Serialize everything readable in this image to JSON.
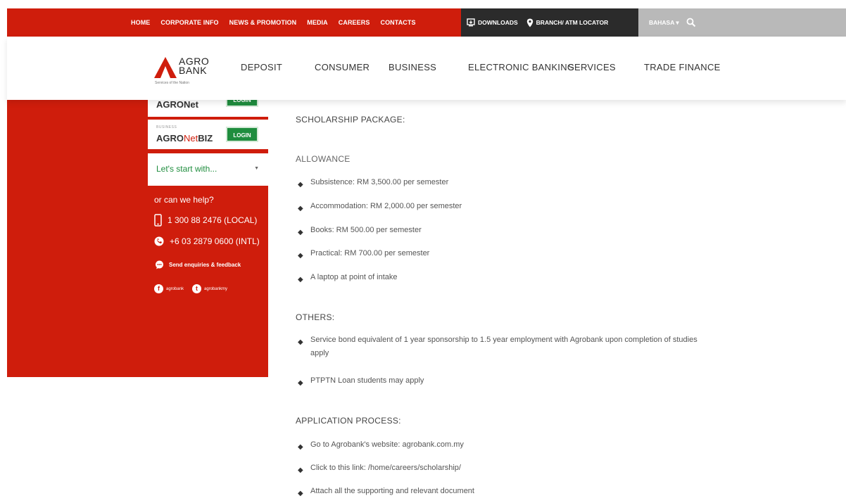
{
  "topbar": {
    "nav": [
      "HOME",
      "CORPORATE INFO",
      "NEWS & PROMOTION",
      "MEDIA",
      "CAREERS",
      "CONTACTS"
    ],
    "downloads": "DOWNLOADS",
    "locator": "BRANCH/ ATM LOCATOR",
    "language": "BAHASA ▾",
    "icons": [
      "download-icon",
      "map-pin-icon",
      "search-icon"
    ]
  },
  "logo": {
    "line1": "AGRO",
    "line2": "BANK",
    "tagline": "Services of the Nation"
  },
  "mainnav": [
    "DEPOSIT",
    "CONSUMER",
    "BUSINESS",
    "ELECTRONIC BANKING",
    "SERVICES",
    "TRADE FINANCE"
  ],
  "sidebar": {
    "agronet": {
      "brand": "AGRONet",
      "login": "LOGIN"
    },
    "agronetbiz": {
      "small": "BUSINESS",
      "brand_bold": "AGRO",
      "brand_light": "Net",
      "brand_end": "BIZ",
      "login": "LOGIN"
    },
    "select_label": "Let's start with...",
    "help": "or can we help?",
    "phone_local": "1 300 88 2476 (LOCAL)",
    "phone_intl": "+6 03 2879 0600 (INTL)",
    "enquiry": "Send enquiries & feedback",
    "facebook": "agrobank",
    "twitter": "agrobankmy"
  },
  "content": {
    "scholarship_heading": "SCHOLARSHIP PACKAGE:",
    "allowance_heading": "ALLOWANCE",
    "allowance_items": [
      "Subsistence: RM 3,500.00 per semester",
      "Accommodation: RM 2,000.00 per semester",
      "Books: RM 500.00 per semester",
      "Practical: RM 700.00 per semester",
      "A laptop at point of intake"
    ],
    "others_heading": "OTHERS:",
    "others_items": [
      "Service bond equivalent of 1 year sponsorship to 1.5 year employment with Agrobank upon completion of studies apply",
      "PTPTN Loan students may apply"
    ],
    "application_heading": "APPLICATION PROCESS:",
    "application_items": [
      "Go to Agrobank's website: agrobank.com.my",
      "Click to this link: /home/careers/scholarship/",
      "Attach all the supporting and relevant document"
    ]
  },
  "colors": {
    "brand_red": "#cf1d0c",
    "login_green": "#1f8d3e",
    "dark_bar": "#2b2b2b",
    "grey_bar": "#b9b9b9"
  }
}
